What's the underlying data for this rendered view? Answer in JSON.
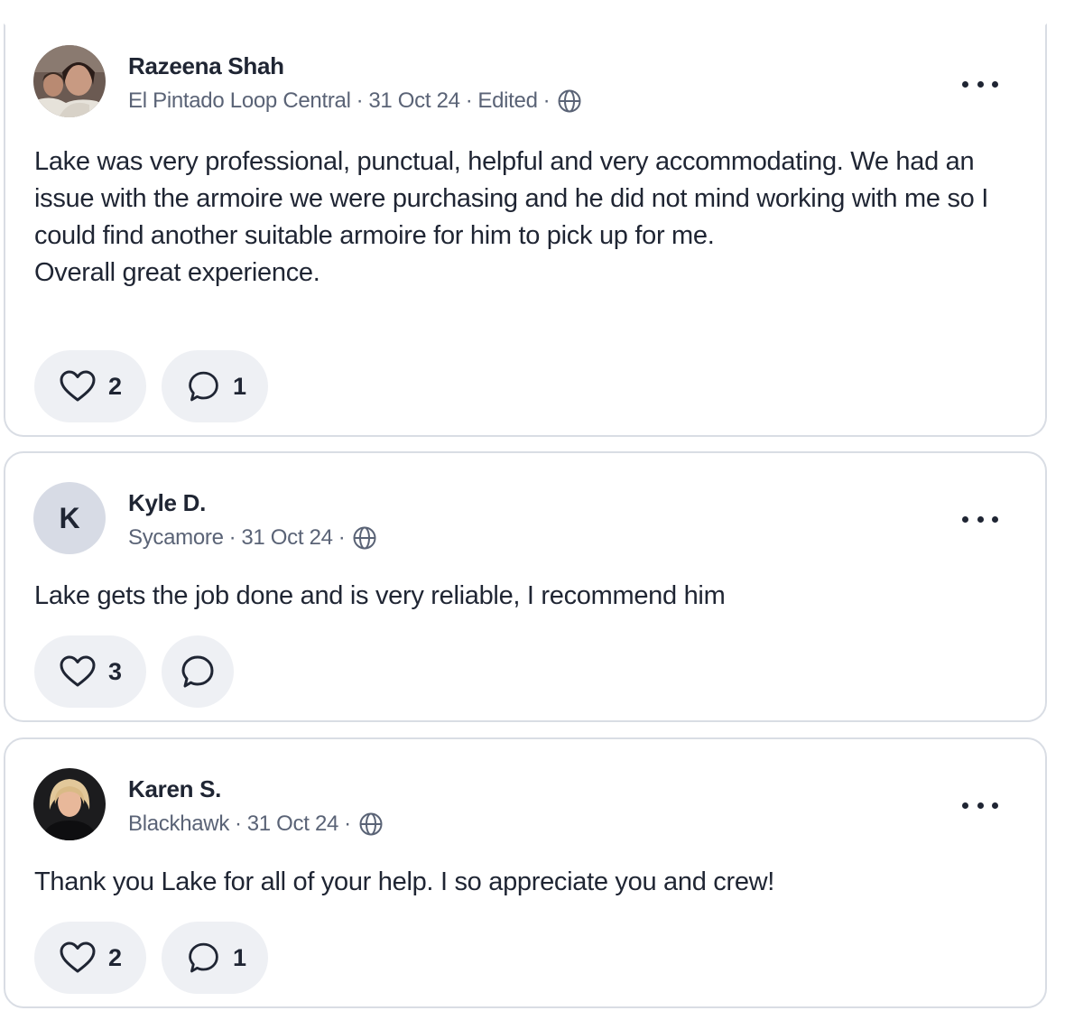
{
  "posts": [
    {
      "author": "Razeena Shah",
      "avatar": {
        "type": "photo",
        "description_icon": "user-photo-avatar"
      },
      "location": "El Pintado Loop Central",
      "date": "31 Oct 24",
      "edited": "Edited",
      "visibility_icon": "globe-icon",
      "separator": "·",
      "body_lines": [
        "Lake was very professional, punctual, helpful and very accommodating. We had an issue with the armoire we were purchasing and he did not mind working with me so I could find another suitable armoire for him to pick up for me.",
        "Overall great experience."
      ],
      "likes": "2",
      "comments": "1"
    },
    {
      "author": "Kyle D.",
      "avatar": {
        "type": "initial",
        "initial": "K"
      },
      "location": "Sycamore",
      "date": "31 Oct 24",
      "visibility_icon": "globe-icon",
      "separator": "·",
      "body_lines": [
        "Lake gets the job done and is very reliable, I recommend him"
      ],
      "likes": "3",
      "comments": ""
    },
    {
      "author": "Karen S.",
      "avatar": {
        "type": "photo",
        "description_icon": "user-photo-avatar"
      },
      "location": "Blackhawk",
      "date": "31 Oct 24",
      "visibility_icon": "globe-icon",
      "separator": "·",
      "body_lines": [
        "Thank you Lake for all of your help. I so appreciate you and crew!"
      ],
      "likes": "2",
      "comments": "1"
    }
  ],
  "colors": {
    "text": "#1f2533",
    "meta": "#5a6376",
    "pill_bg": "#eef0f4",
    "border": "#d9dde4",
    "initial_avatar_bg": "#d7dbe5"
  }
}
